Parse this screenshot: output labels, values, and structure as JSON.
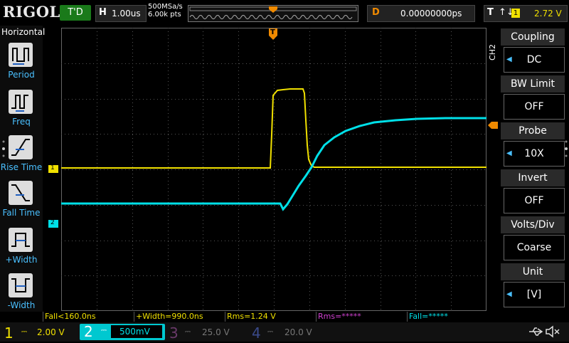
{
  "top": {
    "logo": "RIGOL",
    "run_status": "T'D",
    "h_key": "H",
    "timebase": "1.00us",
    "sample_rate": "500MSa/s",
    "memory_depth": "6.00k pts",
    "delay_key": "D",
    "delay_value": "0.00000000ps",
    "trigger_key": "T",
    "trigger_slope": "↑↓",
    "trigger_source": "1",
    "trigger_level": "2.72 V"
  },
  "left_panel": {
    "title": "Horizontal",
    "items": [
      "Period",
      "Freq",
      "Rise Time",
      "Fall Time",
      "+Width",
      "-Width"
    ]
  },
  "right_panel": {
    "channel_tag": "CH2",
    "items": [
      {
        "title": "Coupling",
        "value": "DC"
      },
      {
        "title": "BW Limit",
        "value": "OFF"
      },
      {
        "title": "Probe",
        "value": "10X"
      },
      {
        "title": "Invert",
        "value": "OFF"
      },
      {
        "title": "Volts/Div",
        "value": "Coarse"
      },
      {
        "title": "Unit",
        "value": "[V]"
      }
    ]
  },
  "measurements": [
    "Fall<160.0ns",
    "+Width=990.0ns",
    "Rms=1.24 V",
    "Rms=*****",
    "Fall=*****"
  ],
  "channels": [
    {
      "num": "1",
      "scale": "2.00 V"
    },
    {
      "num": "2",
      "scale": "500mV"
    },
    {
      "num": "3",
      "scale": "25.0 V"
    },
    {
      "num": "4",
      "scale": "20.0 V"
    }
  ],
  "markers": {
    "ch1": "1",
    "ch2": "2",
    "trigger": "T"
  },
  "colors": {
    "ch1": "#f0e000",
    "ch2": "#00e0e8",
    "ch3": "#d040d0",
    "ch4": "#4a6aff",
    "trigger": "#f08a00",
    "accent": "#4ac0ff"
  },
  "icons": [
    "period-icon",
    "freq-icon",
    "rise-time-icon",
    "fall-time-icon",
    "pos-width-icon",
    "neg-width-icon",
    "usb-icon",
    "speaker-muted-icon"
  ]
}
